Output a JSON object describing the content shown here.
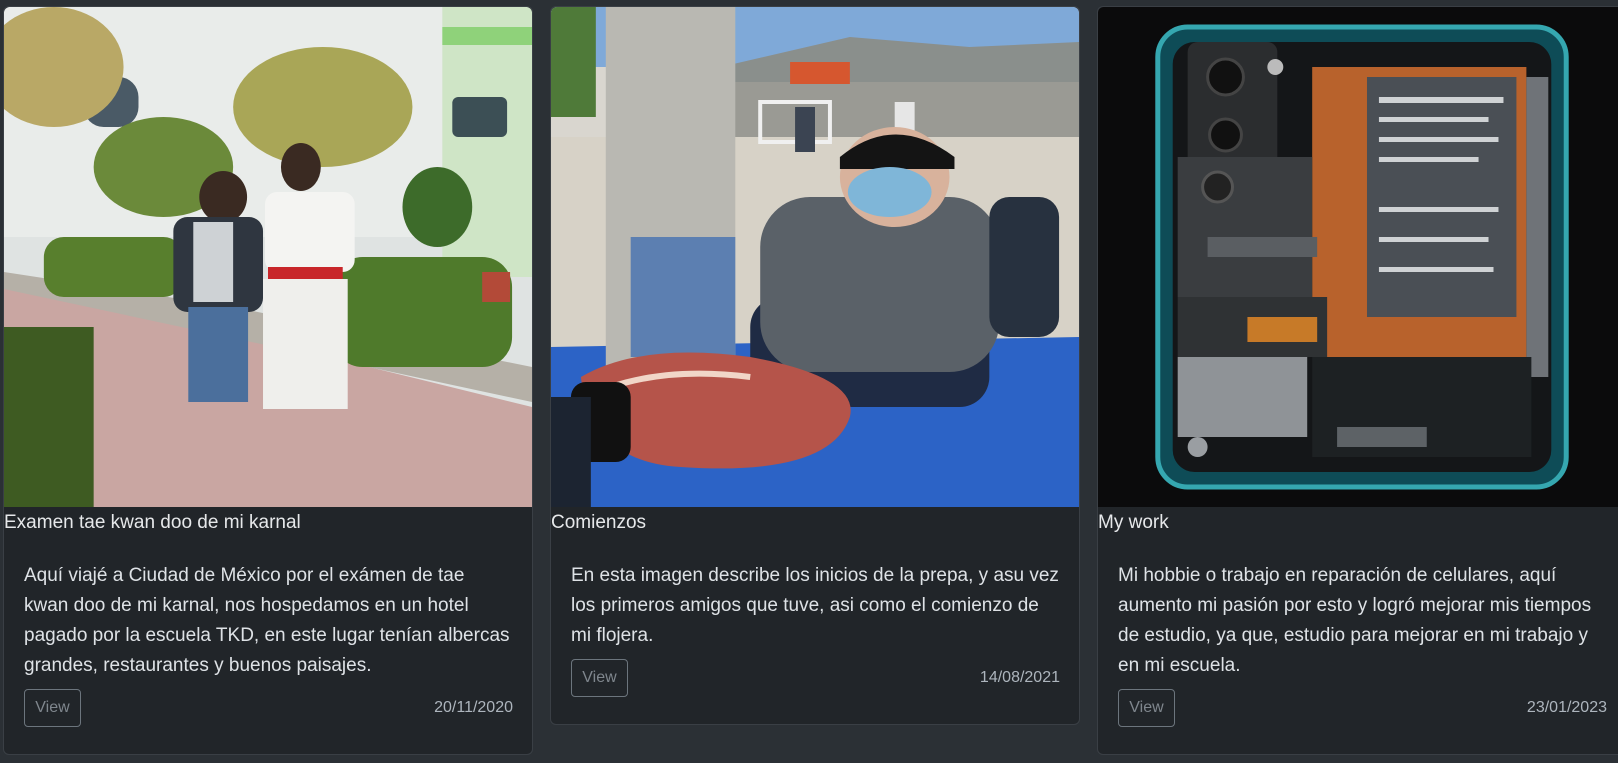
{
  "cards": [
    {
      "title": "Examen tae kwan doo de mi karnal",
      "text": "Aquí viajé a Ciudad de México por el exámen de tae kwan doo de mi karnal, nos hospedamos en un hotel pagado por la escuela TKD, en este lugar tenían albercas grandes, restaurantes y buenos paisajes.",
      "button_label": "View",
      "date": "20/11/2020",
      "image": "photo-two-boys-taekwondo-uniform-garden"
    },
    {
      "title": "Comienzos",
      "text": "En esta imagen describe los inicios de la prepa, y asu vez los primeros amigos que tuve, asi como el comienzo de mi flojera.",
      "button_label": "View",
      "date": "14/08/2021",
      "image": "photo-masked-man-sitting-schoolyard"
    },
    {
      "title": "My work",
      "text": "Mi hobbie o trabajo en reparación de celulares, aquí aumento mi pasión por esto y logró mejorar mis tiempos de estudio, ya que, estudio para mejorar en mi trabajo y en mi escuela.",
      "button_label": "View",
      "date": "23/01/2023",
      "image": "photo-opened-smartphone-internals"
    }
  ],
  "colors": {
    "page_background": "#2b3035",
    "card_background": "#212529",
    "button_border": "#6c757d"
  }
}
